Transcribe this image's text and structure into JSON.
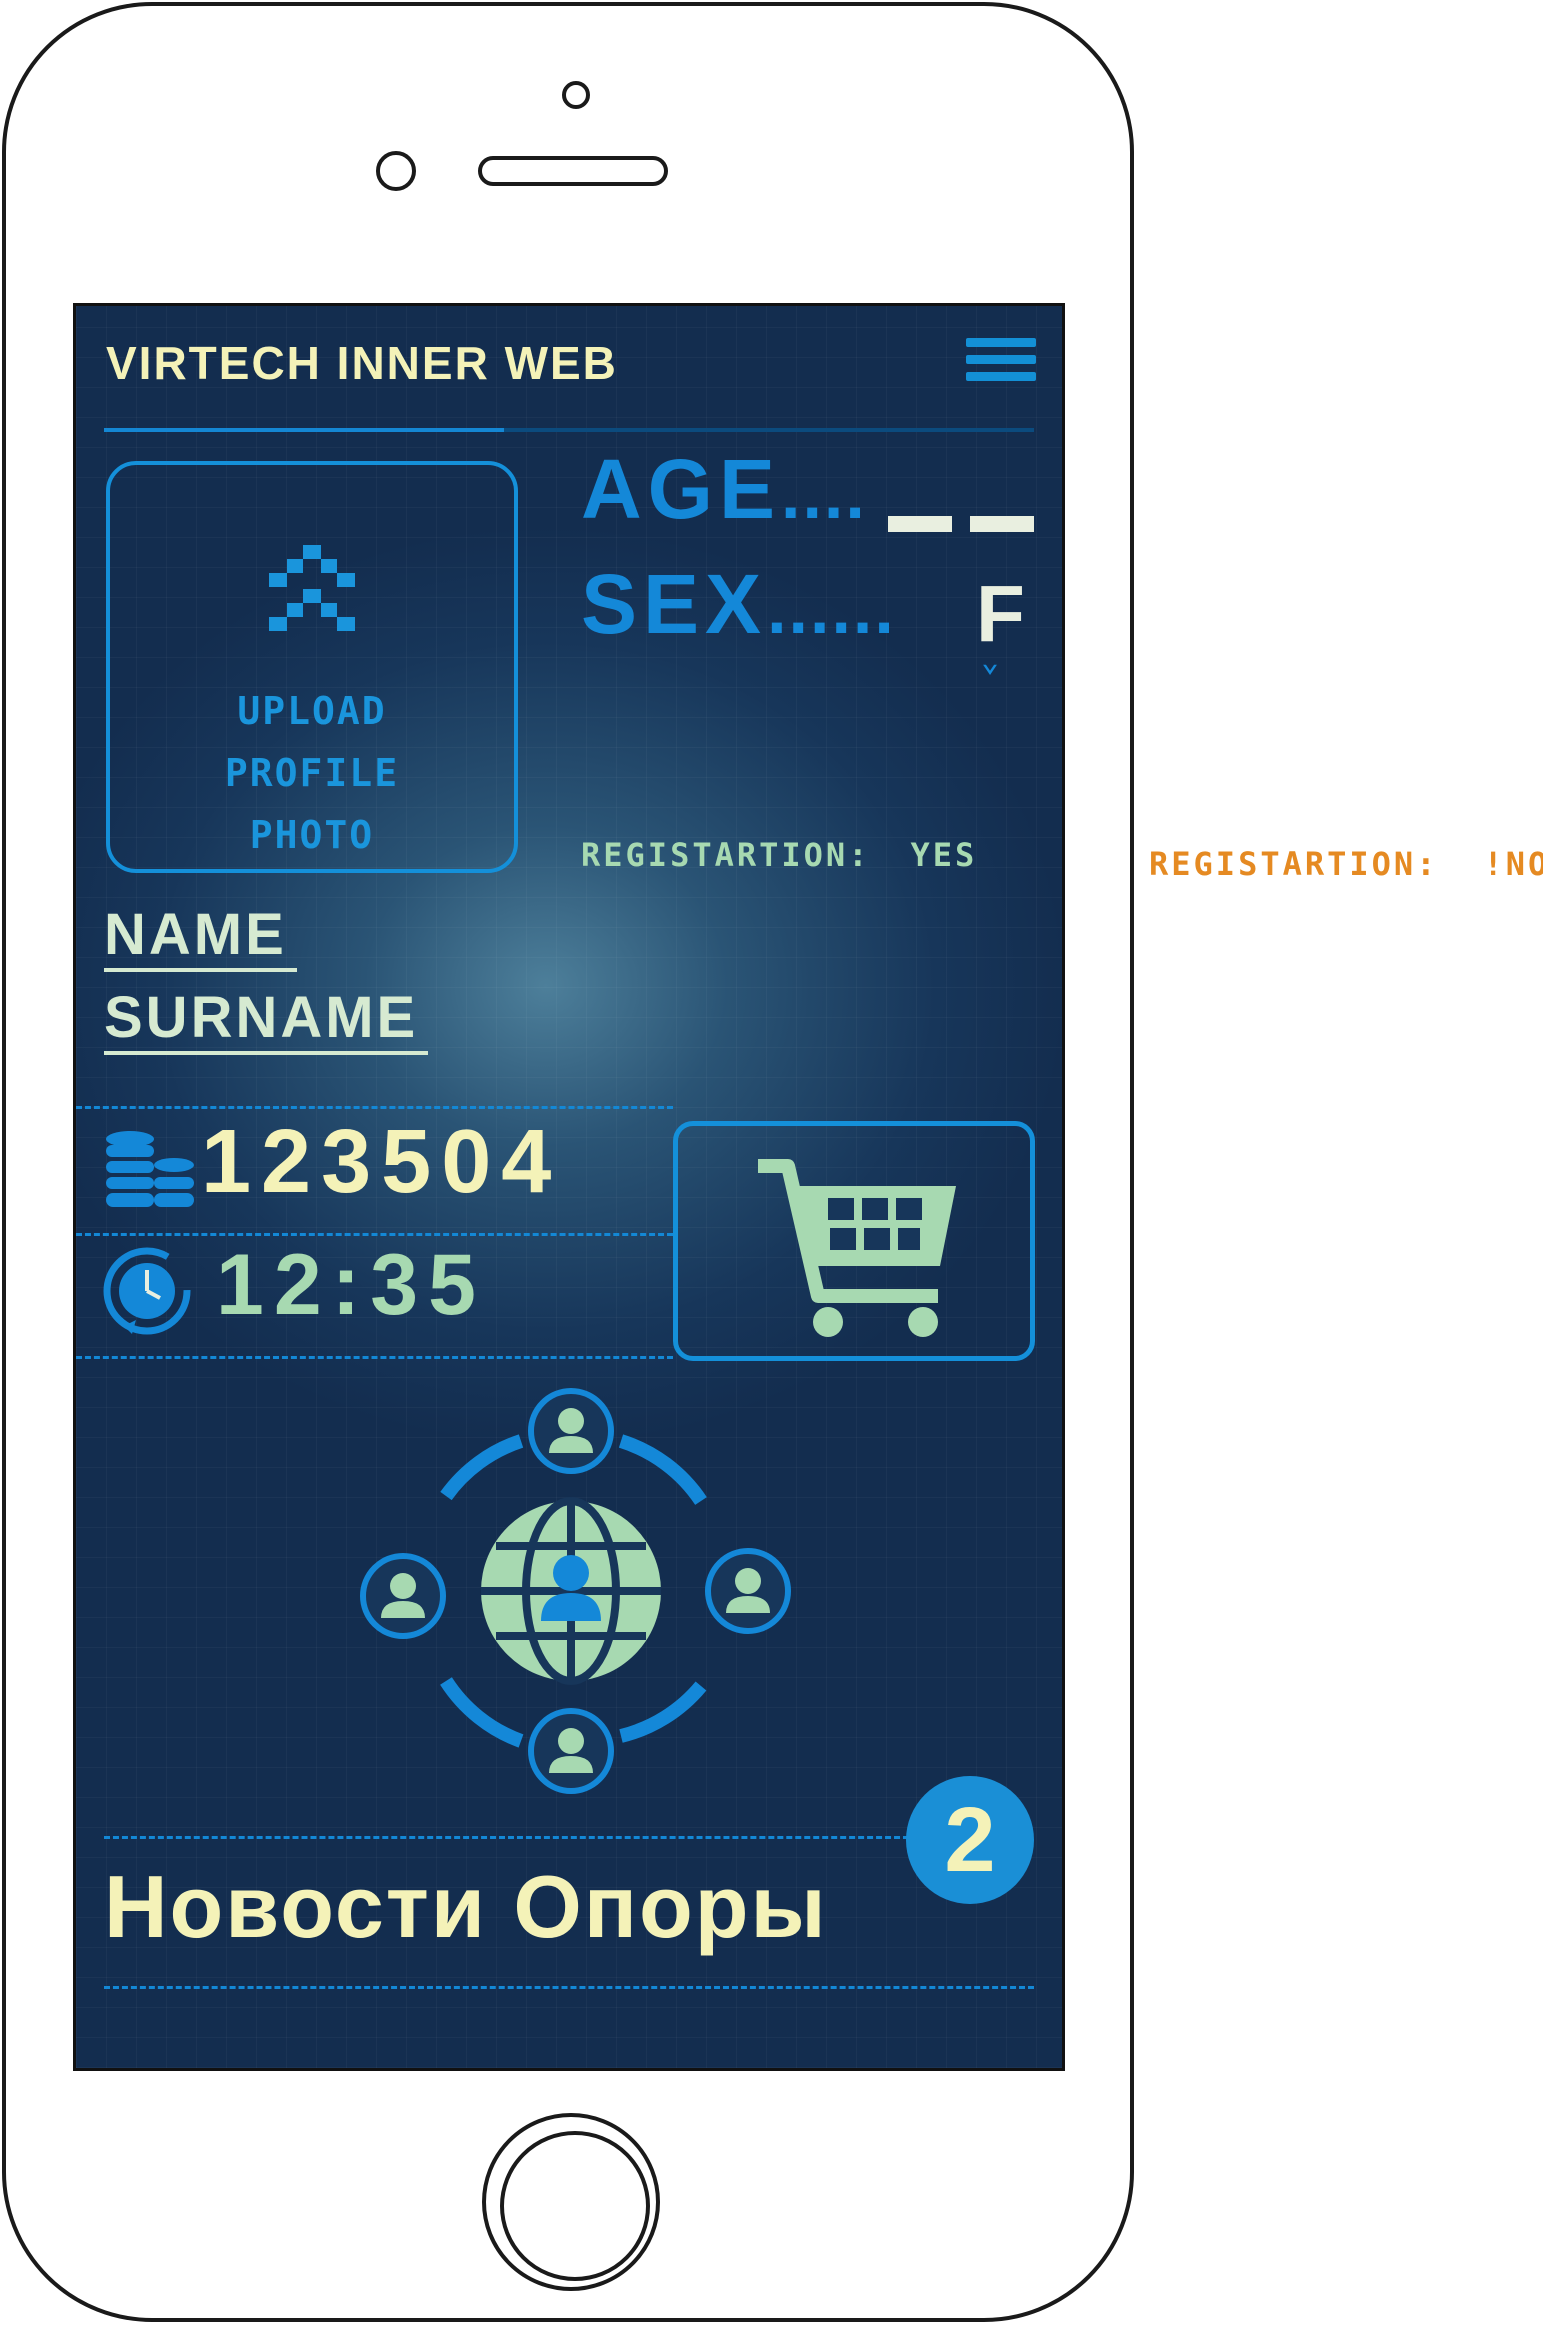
{
  "app": {
    "title": "VIRTECH INNER WEB",
    "menu_icon": "hamburger-menu-icon"
  },
  "profile": {
    "upload_label": [
      "UPLOAD",
      "PROFILE",
      "PHOTO"
    ],
    "age_label": "AGE",
    "age_value": "",
    "sex_label": "SEX",
    "sex_value": "F",
    "registration_label": "REGISTARTION:",
    "registration_value": "YES",
    "name": "NAME",
    "surname": "SURNAME"
  },
  "stats": {
    "coins": "123504",
    "coins_icon": "coin-stack-icon",
    "time": "12:35",
    "time_icon": "clock-icon"
  },
  "cart": {
    "icon": "shopping-cart-icon"
  },
  "network": {
    "icon": "global-network-icon"
  },
  "news": {
    "title": "Новости Опоры",
    "count": "2"
  },
  "variant": {
    "registration_label": "REGISTARTION:",
    "registration_value": "!NO!"
  },
  "colors": {
    "accent": "#1488d8",
    "text_yellow": "#f4f2b8",
    "text_green": "#a7d9b1",
    "background": "#17365a",
    "warning": "#e58a22"
  }
}
